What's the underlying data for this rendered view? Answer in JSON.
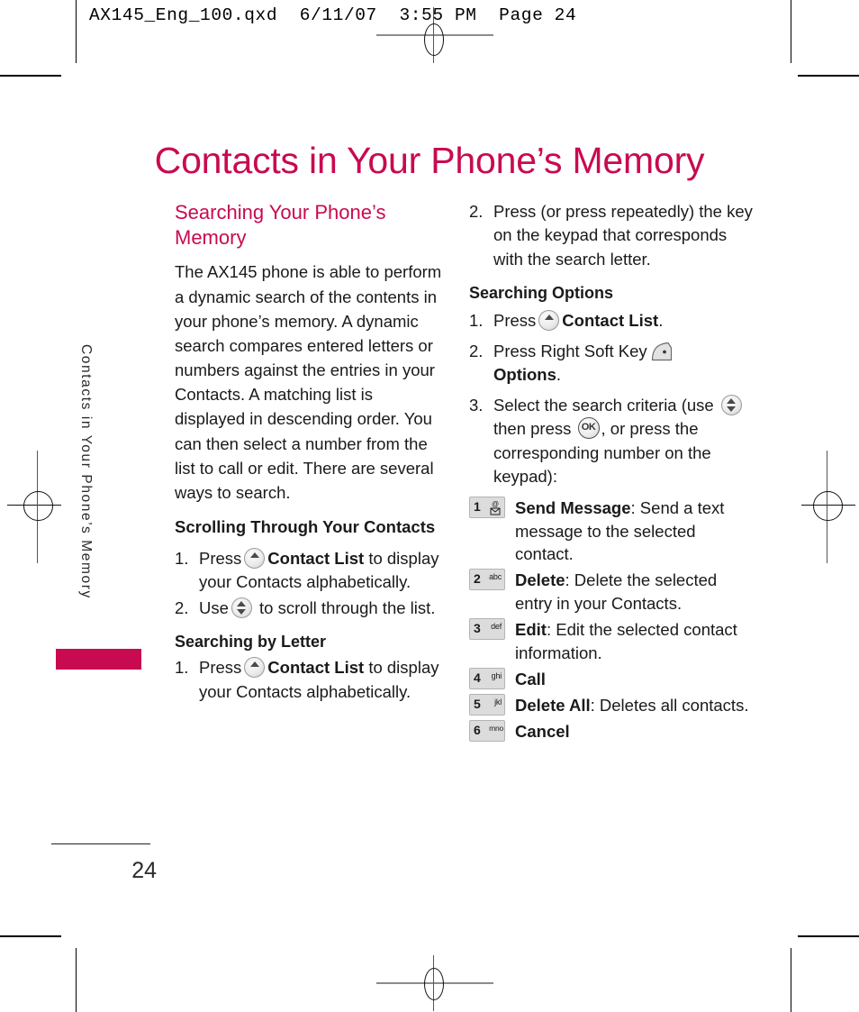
{
  "prepress": {
    "slug": "AX145_Eng_100.qxd  6/11/07  3:55 PM  Page 24"
  },
  "running_head": {
    "vertical_label": "Contacts in Your Phone’s Memory",
    "tab_color": "#c80a50"
  },
  "page": {
    "title": "Contacts in Your Phone’s Memory",
    "number": "24",
    "accent_color": "#c80a50"
  },
  "left_column": {
    "section_heading": "Searching Your Phone’s Memory",
    "intro_paragraph": "The AX145 phone is able to perform a dynamic search of the contents in your phone’s memory. A dynamic search compares entered letters or numbers against the entries in your Contacts. A matching list is displayed in descending order. You can then select a number from the list to call or edit. There are several ways to search.",
    "scrolling_heading": "Scrolling Through Your Contacts",
    "scrolling_steps": [
      {
        "num": "1.",
        "pre": "Press",
        "icon": "nav-up-key-icon",
        "bold": "Contact List",
        "post": " to display your Contacts alphabetically."
      },
      {
        "num": "2.",
        "pre": "Use",
        "icon": "nav-updown-key-icon",
        "bold": "",
        "post": " to scroll through the list."
      }
    ],
    "letter_heading": "Searching by Letter",
    "letter_steps": [
      {
        "num": "1.",
        "pre": "Press",
        "icon": "nav-up-key-icon",
        "bold": "Contact List",
        "post": " to display your Contacts alphabetically."
      }
    ]
  },
  "right_column": {
    "step2_num": "2.",
    "step2_text": "Press (or press repeatedly) the key on the keypad that corresponds with the search letter.",
    "options_heading": "Searching Options",
    "option_steps": [
      {
        "num": "1.",
        "pre": "Press",
        "icon": "nav-up-key-icon",
        "bold": "Contact List",
        "post": "."
      },
      {
        "num": "2.",
        "pre": "Press Right Soft Key",
        "icon": "right-soft-key-icon",
        "bold": "Options",
        "post": "."
      }
    ],
    "step3": {
      "num": "3.",
      "lead": "Select the search criteria (use",
      "icon1": "nav-updown-key-icon",
      "mid": "then press",
      "icon2": "ok-key-icon",
      "tail": ", or press the corresponding number on the keypad):"
    },
    "keypad_options": [
      {
        "key_digit": "1",
        "key_label": "@ ✉",
        "key_icon": "key-1-message-icon",
        "bold": "Send Message",
        "rest": ": Send a text message to the selected contact."
      },
      {
        "key_digit": "2",
        "key_label": "abc",
        "key_icon": "key-2-abc-icon",
        "bold": "Delete",
        "rest": ": Delete the selected entry in your Contacts."
      },
      {
        "key_digit": "3",
        "key_label": "def",
        "key_icon": "key-3-def-icon",
        "bold": "Edit",
        "rest": ": Edit the selected contact information."
      },
      {
        "key_digit": "4",
        "key_label": "ghi",
        "key_icon": "key-4-ghi-icon",
        "bold": "Call",
        "rest": ""
      },
      {
        "key_digit": "5",
        "key_label": "jkl",
        "key_icon": "key-5-jkl-icon",
        "bold": "Delete All",
        "rest": ": Deletes all contacts."
      },
      {
        "key_digit": "6",
        "key_label": "mno",
        "key_icon": "key-6-mno-icon",
        "bold": "Cancel",
        "rest": ""
      }
    ]
  }
}
